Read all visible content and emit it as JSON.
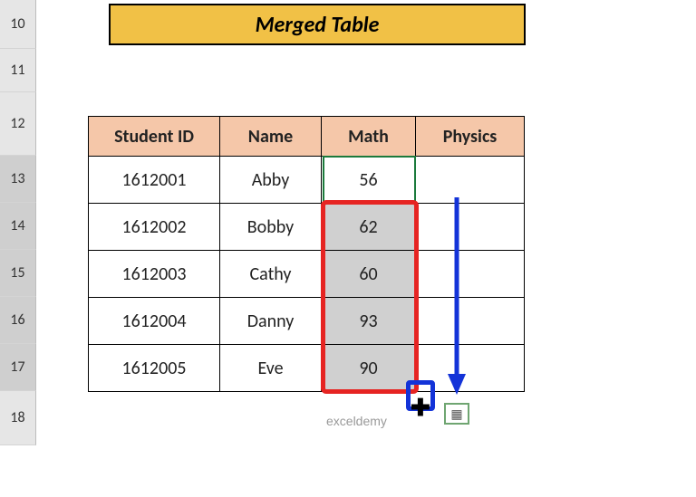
{
  "title": "Merged Table",
  "row_headers": [
    "10",
    "11",
    "12",
    "13",
    "14",
    "15",
    "16",
    "17",
    "18"
  ],
  "table": {
    "headers": [
      "Student ID",
      "Name",
      "Math",
      "Physics"
    ],
    "rows": [
      {
        "id": "1612001",
        "name": "Abby",
        "math": "56",
        "physics": ""
      },
      {
        "id": "1612002",
        "name": "Bobby",
        "math": "62",
        "physics": ""
      },
      {
        "id": "1612003",
        "name": "Cathy",
        "math": "60",
        "physics": ""
      },
      {
        "id": "1612004",
        "name": "Danny",
        "math": "93",
        "physics": ""
      },
      {
        "id": "1612005",
        "name": "Eve",
        "math": "90",
        "physics": ""
      }
    ]
  },
  "watermark": "exceldemy",
  "autofill_icon": "▦"
}
